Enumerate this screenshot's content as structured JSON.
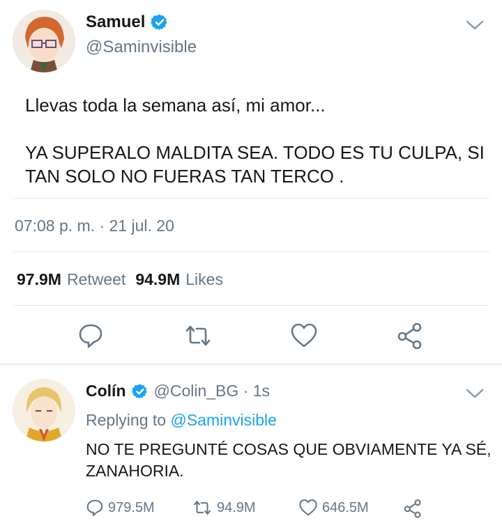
{
  "tweet": {
    "name": "Samuel",
    "handle": "@Saminvisible",
    "text": "Llevas toda la semana así, mi amor...\n\nYA SUPERALO MALDITA SEA. TODO ES TU CULPA, SI TAN SOLO NO FUERAS TAN TERCO .",
    "timestamp": "07:08 p. m. · 21 jul. 20",
    "retweets_count": "97.9M",
    "retweets_label": "Retweet",
    "likes_count": "94.9M",
    "likes_label": "Likes"
  },
  "reply": {
    "name": "Colín",
    "handle_time": "@Colin_BG · 1s",
    "replying_prefix": "Replying to ",
    "replying_mention": "@Saminvisible",
    "text": "NO TE PREGUNTÉ COSAS QUE OBVIAMENTE YA SÉ, ZANAHORIA.",
    "reply_count": "979.5M",
    "retweet_count": "94.9M",
    "like_count": "646.5M"
  },
  "colors": {
    "primary_text": "#14171a",
    "secondary_text": "#657786",
    "link": "#1da1f2",
    "verified": "#1da1f2",
    "divider": "#e1e8ed"
  },
  "icons": [
    "verified-badge-icon",
    "chevron-down-icon",
    "reply-icon",
    "retweet-icon",
    "like-icon",
    "share-icon"
  ]
}
